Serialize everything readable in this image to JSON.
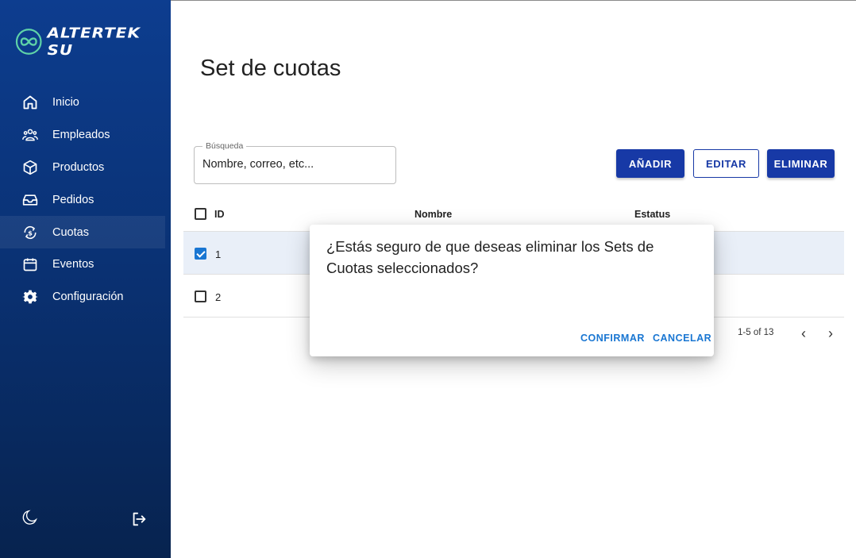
{
  "app": {
    "logo_text": "ALTERTEK SU",
    "brand_color": "#1739a6",
    "sidebar_color": "#0a3275"
  },
  "sidebar": {
    "items": [
      {
        "label": "Inicio",
        "icon": "home-icon"
      },
      {
        "label": "Empleados",
        "icon": "users-icon"
      },
      {
        "label": "Productos",
        "icon": "box-icon"
      },
      {
        "label": "Pedidos",
        "icon": "inbox-icon"
      },
      {
        "label": "Cuotas",
        "icon": "dollar-refresh-icon",
        "active": true
      },
      {
        "label": "Eventos",
        "icon": "calendar-icon"
      },
      {
        "label": "Configuración",
        "icon": "gear-icon"
      }
    ],
    "theme_icon": "moon-icon",
    "logout_icon": "logout-icon"
  },
  "main": {
    "title": "Set de cuotas",
    "search": {
      "legend": "Búsqueda",
      "value": "Nombre, correo, etc..."
    },
    "actions": {
      "add": "AÑADIR",
      "edit": "EDITAR",
      "delete": "ELIMINAR"
    },
    "table": {
      "columns": [
        "ID",
        "Nombre",
        "Estatus"
      ],
      "rows": [
        {
          "id": "1",
          "selected": true
        },
        {
          "id": "2",
          "selected": false
        }
      ]
    },
    "pagination": {
      "range": "1-5 of 13"
    }
  },
  "dialog": {
    "message": "¿Estás seguro de que deseas eliminar los Sets de Cuotas seleccionados?",
    "confirm": "CONFIRMAR",
    "cancel": "CANCELAR"
  }
}
